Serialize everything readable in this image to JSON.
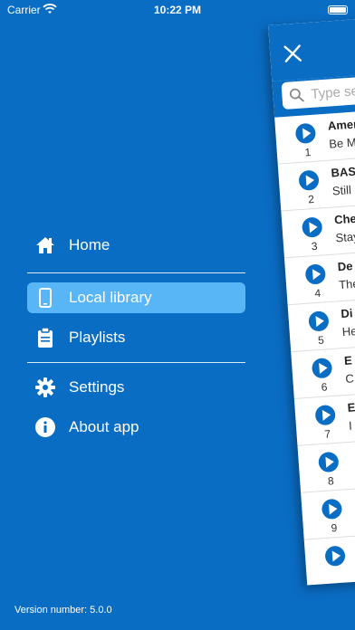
{
  "status_bar": {
    "carrier": "Carrier",
    "time": "10:22 PM"
  },
  "menu": {
    "items": [
      {
        "label": "Home",
        "icon": "home-icon"
      },
      {
        "label": "Local library",
        "icon": "phone-icon",
        "active": true
      },
      {
        "label": "Playlists",
        "icon": "clipboard-icon"
      },
      {
        "label": "Settings",
        "icon": "gear-icon"
      },
      {
        "label": "About app",
        "icon": "info-icon"
      }
    ]
  },
  "version": "Version number: 5.0.0",
  "panel": {
    "search_placeholder": "Type sea",
    "tracks": [
      {
        "number": "1",
        "title": "Amer",
        "subtitle": "Be M"
      },
      {
        "number": "2",
        "title": "BAS",
        "subtitle": "Still"
      },
      {
        "number": "3",
        "title": "Che",
        "subtitle": "Stay"
      },
      {
        "number": "4",
        "title": "De",
        "subtitle": "The"
      },
      {
        "number": "5",
        "title": "Di",
        "subtitle": "He"
      },
      {
        "number": "6",
        "title": "E",
        "subtitle": "C"
      },
      {
        "number": "7",
        "title": "E",
        "subtitle": "I"
      },
      {
        "number": "8",
        "title": "",
        "subtitle": ""
      },
      {
        "number": "9",
        "title": "",
        "subtitle": ""
      },
      {
        "number": "",
        "title": "",
        "subtitle": ""
      }
    ]
  },
  "colors": {
    "background": "#0a6dc4",
    "active_item": "#58b6f7",
    "accent": "#0a6dc4"
  }
}
